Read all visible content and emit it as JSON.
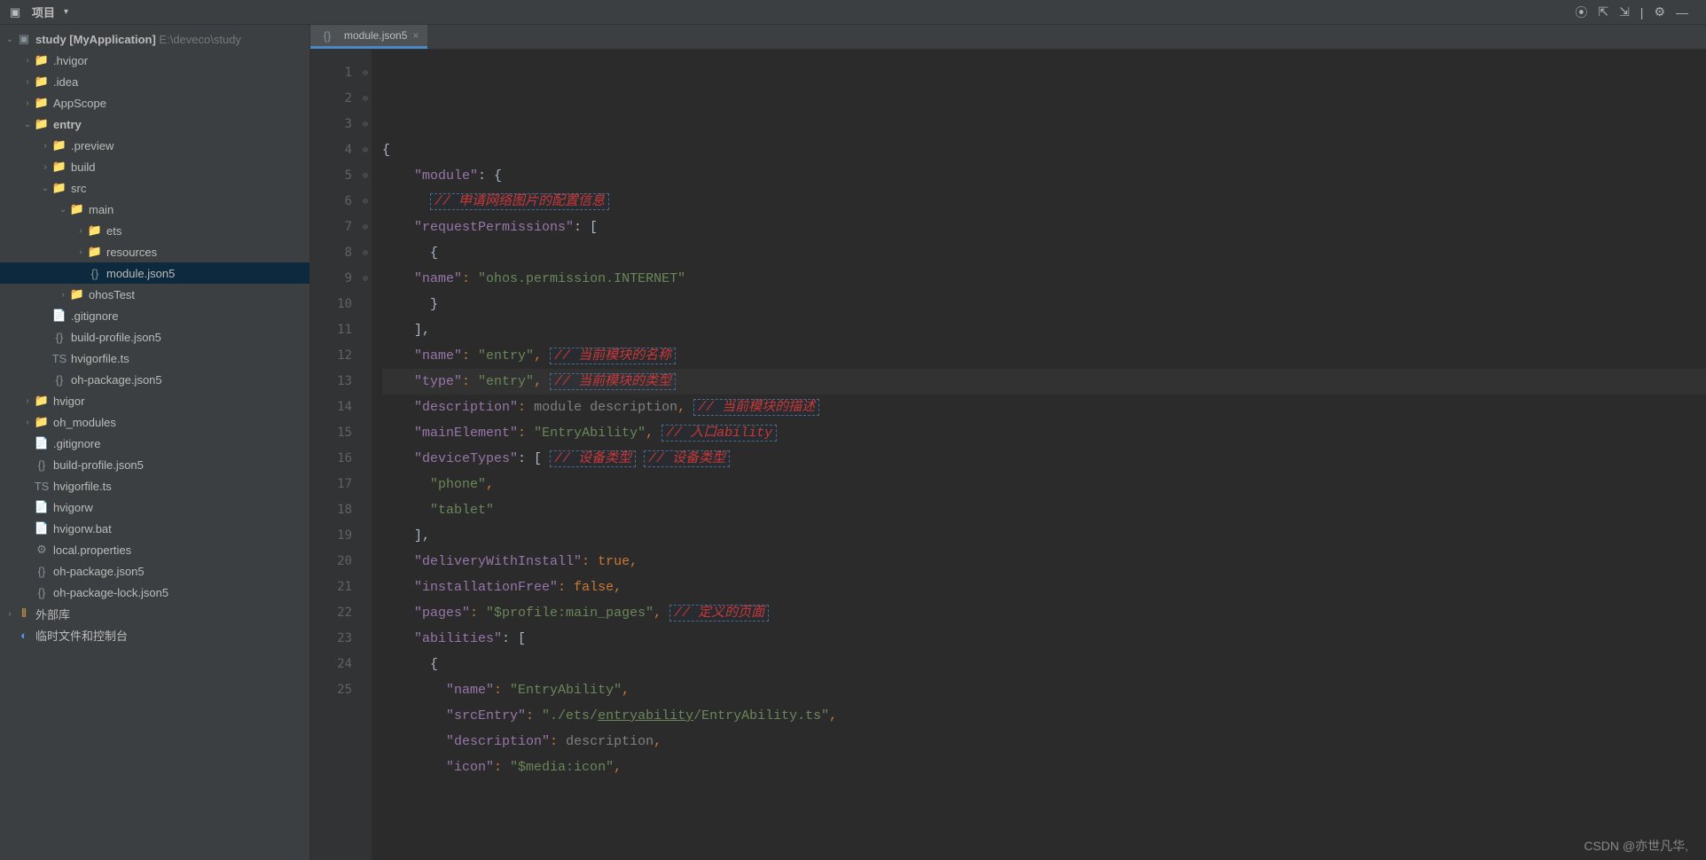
{
  "toolbar": {
    "project_label": "项目",
    "icons": [
      "target-icon",
      "collapse-icon",
      "expand-icon",
      "divider",
      "settings-icon",
      "minimize-icon"
    ]
  },
  "tab": {
    "filename": "module.json5"
  },
  "tree": {
    "root": {
      "name": "study",
      "suffix": "[MyApplication]",
      "path": "E:\\deveco\\study"
    },
    "items": [
      {
        "indent": 1,
        "chev": ">",
        "icon": "folder",
        "label": ".hvigor"
      },
      {
        "indent": 1,
        "chev": ">",
        "icon": "folder",
        "label": ".idea"
      },
      {
        "indent": 1,
        "chev": ">",
        "icon": "folder",
        "label": "AppScope"
      },
      {
        "indent": 1,
        "chev": "v",
        "icon": "folder-o",
        "label": "entry",
        "bold": true
      },
      {
        "indent": 2,
        "chev": ">",
        "icon": "folder-o",
        "label": ".preview"
      },
      {
        "indent": 2,
        "chev": ">",
        "icon": "folder-o",
        "label": "build"
      },
      {
        "indent": 2,
        "chev": "v",
        "icon": "folder",
        "label": "src"
      },
      {
        "indent": 3,
        "chev": "v",
        "icon": "folder",
        "label": "main"
      },
      {
        "indent": 4,
        "chev": ">",
        "icon": "folder",
        "label": "ets"
      },
      {
        "indent": 4,
        "chev": ">",
        "icon": "folder",
        "label": "resources"
      },
      {
        "indent": 4,
        "chev": "",
        "icon": "file-json",
        "label": "module.json5",
        "selected": true
      },
      {
        "indent": 3,
        "chev": ">",
        "icon": "folder",
        "label": "ohosTest"
      },
      {
        "indent": 2,
        "chev": "",
        "icon": "file",
        "label": ".gitignore"
      },
      {
        "indent": 2,
        "chev": "",
        "icon": "file-json",
        "label": "build-profile.json5"
      },
      {
        "indent": 2,
        "chev": "",
        "icon": "file-ts",
        "label": "hvigorfile.ts"
      },
      {
        "indent": 2,
        "chev": "",
        "icon": "file-json",
        "label": "oh-package.json5"
      },
      {
        "indent": 1,
        "chev": ">",
        "icon": "folder",
        "label": "hvigor"
      },
      {
        "indent": 1,
        "chev": ">",
        "icon": "folder-o",
        "label": "oh_modules"
      },
      {
        "indent": 1,
        "chev": "",
        "icon": "file",
        "label": ".gitignore"
      },
      {
        "indent": 1,
        "chev": "",
        "icon": "file-json",
        "label": "build-profile.json5"
      },
      {
        "indent": 1,
        "chev": "",
        "icon": "file-ts",
        "label": "hvigorfile.ts"
      },
      {
        "indent": 1,
        "chev": "",
        "icon": "file",
        "label": "hvigorw"
      },
      {
        "indent": 1,
        "chev": "",
        "icon": "file",
        "label": "hvigorw.bat"
      },
      {
        "indent": 1,
        "chev": "",
        "icon": "file-prop",
        "label": "local.properties"
      },
      {
        "indent": 1,
        "chev": "",
        "icon": "file-json",
        "label": "oh-package.json5"
      },
      {
        "indent": 1,
        "chev": "",
        "icon": "file-json",
        "label": "oh-package-lock.json5"
      }
    ],
    "extlib": "外部库",
    "scratch": "临时文件和控制台"
  },
  "code": {
    "lines": [
      {
        "n": 1,
        "fold": "⊖",
        "raw": "{"
      },
      {
        "n": 2,
        "fold": "⊖",
        "k": "module",
        "after": ": {"
      },
      {
        "n": 3,
        "fold": "",
        "cmt": "// 申请网络图片的配置信息"
      },
      {
        "n": 4,
        "fold": "⊖",
        "k": "requestPermissions",
        "after": ": ["
      },
      {
        "n": 5,
        "fold": "⊖",
        "raw": "      {"
      },
      {
        "n": 6,
        "fold": "",
        "k": "name",
        "v": "ohos.permission.INTERNET"
      },
      {
        "n": 7,
        "fold": "",
        "raw": "      }"
      },
      {
        "n": 8,
        "fold": "⊖",
        "raw": "    ],"
      },
      {
        "n": 9,
        "fold": "",
        "k": "name",
        "v": "entry",
        "comma": true,
        "cmt": "// 当前模块的名称"
      },
      {
        "n": 10,
        "fold": "",
        "k": "type",
        "v": "entry",
        "comma": true,
        "cmt": "// 当前模块的类型",
        "hl": true
      },
      {
        "n": 11,
        "fold": "",
        "k": "description",
        "dim": "module description",
        "comma": true,
        "cmt": "// 当前模块的描述"
      },
      {
        "n": 12,
        "fold": "",
        "k": "mainElement",
        "v": "EntryAbility",
        "comma": true,
        "cmt": "// 入口ability"
      },
      {
        "n": 13,
        "fold": "⊖",
        "k": "deviceTypes",
        "after": ": [",
        "cmt": "// 设备类型"
      },
      {
        "n": 14,
        "fold": "",
        "v2": "phone",
        "comma": true
      },
      {
        "n": 15,
        "fold": "",
        "v2": "tablet"
      },
      {
        "n": 16,
        "fold": "⊖",
        "raw": "    ],"
      },
      {
        "n": 17,
        "fold": "",
        "k": "deliveryWithInstall",
        "kw": "true",
        "comma": true
      },
      {
        "n": 18,
        "fold": "",
        "k": "installationFree",
        "kw": "false",
        "comma": true
      },
      {
        "n": 19,
        "fold": "",
        "k": "pages",
        "v": "$profile:main_pages",
        "comma": true,
        "cmt": "// 定义的页面"
      },
      {
        "n": 20,
        "fold": "⊖",
        "k": "abilities",
        "after": ": ["
      },
      {
        "n": 21,
        "fold": "⊖",
        "raw": "      {"
      },
      {
        "n": 22,
        "fold": "",
        "k2": "name",
        "v": "EntryAbility",
        "comma": true
      },
      {
        "n": 23,
        "fold": "",
        "k2": "srcEntry",
        "path": "./ets/entryability/EntryAbility.ts",
        "comma": true
      },
      {
        "n": 24,
        "fold": "",
        "k2": "description",
        "dim": "description",
        "comma": true
      },
      {
        "n": 25,
        "fold": "",
        "k2": "icon",
        "v": "$media:icon",
        "comma": true
      }
    ]
  },
  "watermark": "CSDN @亦世凡华,"
}
